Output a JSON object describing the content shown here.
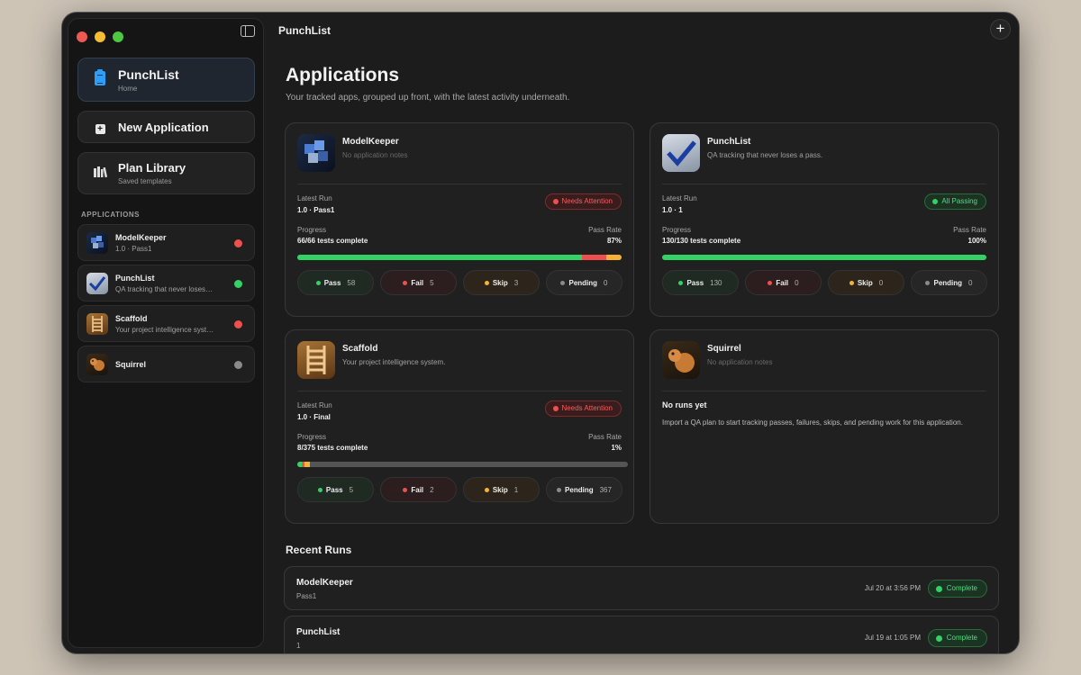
{
  "window": {
    "title": "PunchList"
  },
  "sidebar": {
    "home": {
      "title": "PunchList",
      "subtitle": "Home"
    },
    "new_app": {
      "label": "New Application"
    },
    "plan_library": {
      "title": "Plan Library",
      "subtitle": "Saved templates"
    },
    "section_label": "APPLICATIONS",
    "apps": [
      {
        "name": "ModelKeeper",
        "subtitle": "1.0 · Pass1",
        "status_color": "#ee5050",
        "icon": "cubes-icon"
      },
      {
        "name": "PunchList",
        "subtitle": "QA tracking that never loses a pass.",
        "status_color": "#34d164",
        "icon": "checkmark-icon"
      },
      {
        "name": "Scaffold",
        "subtitle": "Your project intelligence system.",
        "status_color": "#ee5050",
        "icon": "ladder-icon"
      },
      {
        "name": "Squirrel",
        "subtitle": "",
        "status_color": "#8a8a8a",
        "icon": "squirrel-icon"
      }
    ]
  },
  "main": {
    "title": "Applications",
    "subtitle": "Your tracked apps, grouped up front, with the latest activity underneath.",
    "cards": [
      {
        "name": "ModelKeeper",
        "note": "No application notes",
        "latest_run_label": "Latest Run",
        "latest_run": "1.0 · Pass1",
        "status": "Needs Attention",
        "progress_label": "Progress",
        "progress": "66/66 tests complete",
        "pass_rate_label": "Pass Rate",
        "pass_rate": "87%",
        "chips": {
          "pass_label": "Pass",
          "pass": "58",
          "fail_label": "Fail",
          "fail": "5",
          "skip_label": "Skip",
          "skip": "3",
          "pending_label": "Pending",
          "pending": "0"
        }
      },
      {
        "name": "PunchList",
        "note": "QA tracking that never loses a pass.",
        "latest_run_label": "Latest Run",
        "latest_run": "1.0 · 1",
        "status": "All Passing",
        "progress_label": "Progress",
        "progress": "130/130 tests complete",
        "pass_rate_label": "Pass Rate",
        "pass_rate": "100%",
        "chips": {
          "pass_label": "Pass",
          "pass": "130",
          "fail_label": "Fail",
          "fail": "0",
          "skip_label": "Skip",
          "skip": "0",
          "pending_label": "Pending",
          "pending": "0"
        }
      },
      {
        "name": "Scaffold",
        "note": "Your project intelligence system.",
        "latest_run_label": "Latest Run",
        "latest_run": "1.0 · Final",
        "status": "Needs Attention",
        "progress_label": "Progress",
        "progress": "8/375 tests complete",
        "pass_rate_label": "Pass Rate",
        "pass_rate": "1%",
        "chips": {
          "pass_label": "Pass",
          "pass": "5",
          "fail_label": "Fail",
          "fail": "2",
          "skip_label": "Skip",
          "skip": "1",
          "pending_label": "Pending",
          "pending": "367"
        }
      },
      {
        "name": "Squirrel",
        "note": "No application notes",
        "empty_title": "No runs yet",
        "empty_text": "Import a QA plan to start tracking passes, failures, skips, and pending work for this application."
      }
    ],
    "recent_title": "Recent Runs",
    "recent_runs": [
      {
        "name": "ModelKeeper",
        "run": "Pass1",
        "date": "Jul 20 at 3:56 PM",
        "status": "Complete"
      },
      {
        "name": "PunchList",
        "run": "1",
        "date": "Jul 19 at 1:05 PM",
        "status": "Complete"
      }
    ]
  },
  "colors": {
    "pass": "#34d164",
    "fail": "#ee5050",
    "skip": "#f5b234",
    "pending": "#8a8a8a"
  }
}
